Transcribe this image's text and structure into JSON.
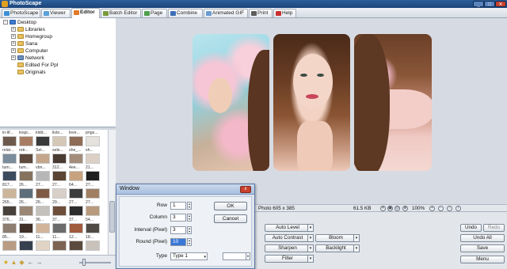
{
  "window": {
    "title": "PhotoScape"
  },
  "tabs": [
    {
      "label": "PhotoScape",
      "color": "#3d8fd6"
    },
    {
      "label": "Viewer",
      "color": "#5aa2d8"
    },
    {
      "label": "Editor",
      "color": "#e07a2a"
    },
    {
      "label": "Batch Editor",
      "color": "#7a9a3c"
    },
    {
      "label": "Page",
      "color": "#4fa04c"
    },
    {
      "label": "Combine",
      "color": "#3c6fb5"
    },
    {
      "label": "Animated GIF",
      "color": "#6a9cd1"
    },
    {
      "label": "Print",
      "color": "#5d5d5d"
    },
    {
      "label": "Help",
      "color": "#c83030"
    }
  ],
  "tree": [
    {
      "label": "Desktop",
      "expander": "−",
      "type": "desk"
    },
    {
      "label": "Libraries",
      "expander": "+",
      "type": "folder"
    },
    {
      "label": "Homegroup",
      "expander": "+",
      "type": "folder"
    },
    {
      "label": "Sana",
      "expander": "+",
      "type": "folder"
    },
    {
      "label": "Computer",
      "expander": "+",
      "type": "folder"
    },
    {
      "label": "Network",
      "expander": "+",
      "type": "net"
    },
    {
      "label": "Edited For Ppl",
      "expander": "",
      "type": "folder"
    },
    {
      "label": "Originals",
      "expander": "",
      "type": "folder"
    }
  ],
  "thumbnails": {
    "row_labels": [
      [
        "in-lif...",
        "inspi...",
        "kldd...",
        "listo...",
        "love...",
        "pngs..."
      ],
      [
        "relat...",
        "retr...",
        "Sel...",
        "sele...",
        "she_...",
        "sh..."
      ],
      [
        "tum...",
        "tum...",
        "vbn...",
        "312...",
        "4ee...",
        "21..."
      ],
      [
        "817...",
        "26...",
        "27...",
        "27...",
        "64...",
        "27..."
      ],
      [
        "265...",
        "26...",
        "26...",
        "29...",
        "27...",
        "27..."
      ],
      [
        "376...",
        "31...",
        "36...",
        "37...",
        "37...",
        "54..."
      ],
      [
        "85...",
        "19...",
        "11...",
        "11...",
        "12...",
        "18..."
      ]
    ],
    "colors": [
      [
        "#6e5a4c",
        "#a77e63",
        "#3a3a3a",
        "#d6c8b7",
        "#8f6c55",
        "#e5e2dd"
      ],
      [
        "#7b8c9c",
        "#5e4a3d",
        "#c4a68c",
        "#4a3b32",
        "#a38c7a",
        "#dcd0c4"
      ],
      [
        "#3c4a5e",
        "#86735e",
        "#b7b7b7",
        "#5a4434",
        "#c7a27e",
        "#1e1e1e"
      ],
      [
        "#cdb59b",
        "#5d6d7a",
        "#7f5a44",
        "#d8d0c8",
        "#3d3d3d",
        "#a17f62"
      ],
      [
        "#48403a",
        "#9a8774",
        "#c4c0bb",
        "#6d4e3a",
        "#2c2c2c",
        "#b89a7c"
      ],
      [
        "#8c7d70",
        "#3e2f27",
        "#d1b49a",
        "#6b6b6b",
        "#a05a3c",
        "#504a45"
      ],
      [
        "#b89c83",
        "#36404e",
        "#e1d4c5",
        "#7d6352",
        "#5b4a3e",
        "#c8c2ba"
      ]
    ]
  },
  "status": {
    "photo_info": "Photo 605 x 385",
    "file_size": "61.5 KB",
    "zoom": "100%"
  },
  "editor": {
    "auto_level": "Auto Level",
    "auto_contrast": "Auto Contrast",
    "bloom": "Bloom",
    "sharpen": "Sharpen",
    "backlight": "Backlight",
    "filter": "Filter",
    "undo": "Undo",
    "redo": "Redo",
    "undo_all": "Undo All",
    "save": "Save",
    "menu": "Menu"
  },
  "dialog": {
    "title": "Window",
    "close": "x",
    "fields": [
      {
        "label": "Row",
        "value": "1"
      },
      {
        "label": "Column",
        "value": "3"
      },
      {
        "label": "Interval (Pixel)",
        "value": "3"
      },
      {
        "label": "Round (Pixel)",
        "value": "10"
      }
    ],
    "type_label": "Type",
    "type_value": "Type 1",
    "ok": "OK",
    "cancel": "Cancel"
  }
}
